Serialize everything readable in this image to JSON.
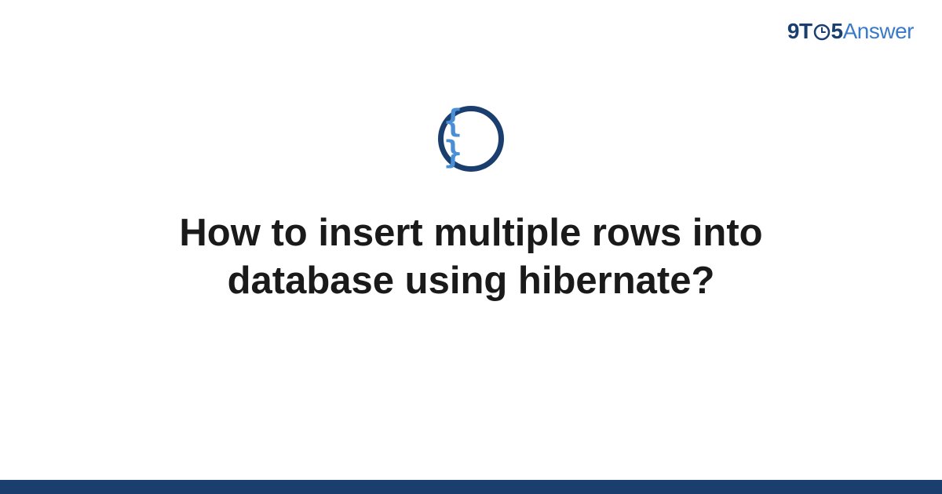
{
  "logo": {
    "nine": "9",
    "t": "T",
    "five": "5",
    "answer": "Answer"
  },
  "icon": {
    "braces": "{ }"
  },
  "title": "How to insert multiple rows into database using hibernate?",
  "colors": {
    "dark_blue": "#1a3e6e",
    "light_blue": "#4a8fd6",
    "link_blue": "#3a7ac9"
  }
}
